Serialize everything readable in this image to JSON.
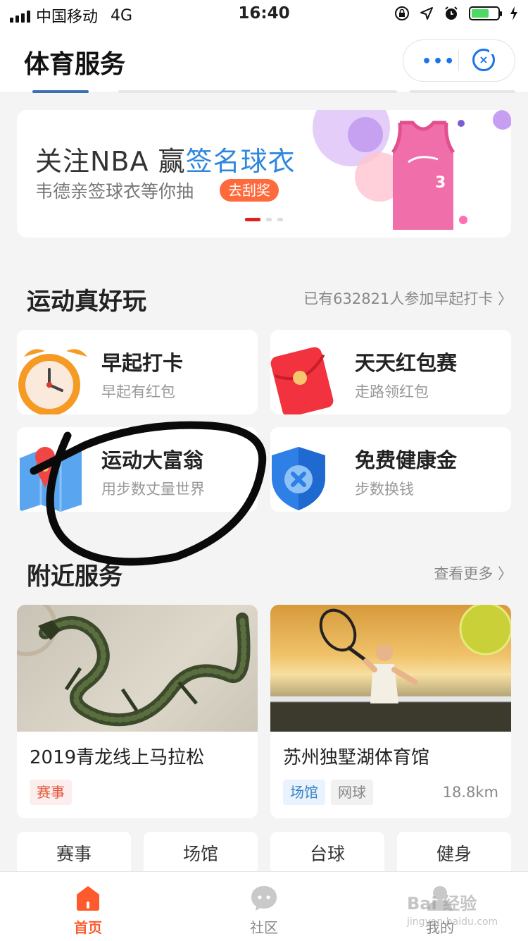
{
  "status_bar": {
    "carrier": "中国移动",
    "network": "4G",
    "time": "16:40"
  },
  "header": {
    "title": "体育服务",
    "more_icon": "more-dots-icon",
    "close_icon": "close-mini-program-icon"
  },
  "banner": {
    "title_prefix": "关注NBA 赢",
    "title_highlight": "签名球衣",
    "subtitle": "韦德亲签球衣等你抽",
    "button": "去刮奖",
    "accent": "#2e86de",
    "button_color": "#ff6a3d"
  },
  "fun_section": {
    "title": "运动真好玩",
    "more": "已有632821人参加早起打卡 〉",
    "cards": [
      {
        "title": "早起打卡",
        "subtitle": "早起有红包",
        "icon": "alarm-clock-icon"
      },
      {
        "title": "天天红包赛",
        "subtitle": "走路领红包",
        "icon": "red-envelope-icon"
      },
      {
        "title": "运动大富翁",
        "subtitle": "用步数丈量世界",
        "icon": "map-pin-icon"
      },
      {
        "title": "免费健康金",
        "subtitle": "步数换钱",
        "icon": "shield-plus-icon"
      }
    ]
  },
  "nearby_section": {
    "title": "附近服务",
    "more": "查看更多 〉",
    "cards": [
      {
        "title": "2019青龙线上马拉松",
        "tags": [
          "赛事"
        ],
        "distance": ""
      },
      {
        "title": "苏州独墅湖体育馆",
        "tags": [
          "场馆",
          "网球"
        ],
        "distance": "18.8km"
      }
    ]
  },
  "categories": [
    "赛事",
    "场馆",
    "台球",
    "健身"
  ],
  "tabbar": [
    {
      "label": "首页",
      "icon": "home-icon",
      "active": true
    },
    {
      "label": "社区",
      "icon": "chat-bubble-icon",
      "active": false
    },
    {
      "label": "我的",
      "icon": "profile-icon",
      "active": false
    }
  ],
  "watermark": {
    "brand": "Bai 经验",
    "url": "jingyan.baidu.com"
  },
  "colors": {
    "active_tab": "#ff5a2e",
    "highlight": "#2e86de"
  }
}
